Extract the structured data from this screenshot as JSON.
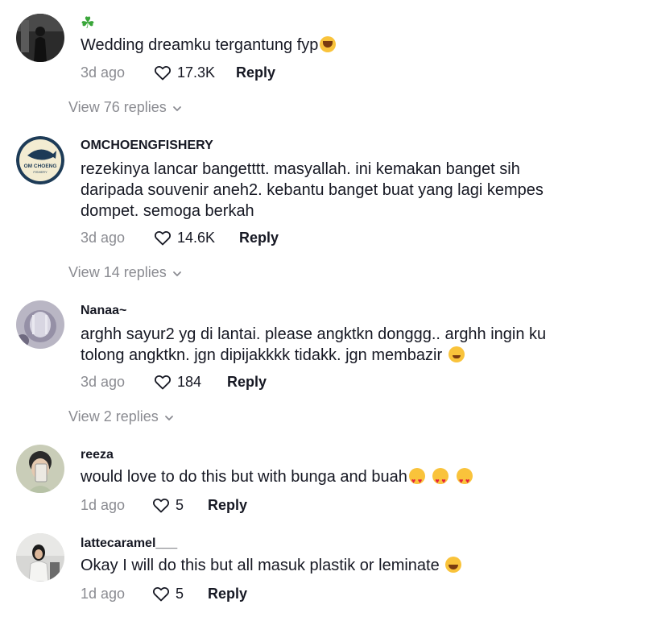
{
  "comments": [
    {
      "username": "☘",
      "text": "Wedding dreamku tergantung fyp",
      "time": "3d ago",
      "likes": "17.3K",
      "reply_label": "Reply",
      "view_replies": "View 76 replies",
      "avatar_icon": "person-photo-avatar"
    },
    {
      "username": "OMCHOENGFISHERY",
      "text": "rezekinya lancar bangetttt. masyallah. ini kemakan banget sih daripada souvenir aneh2. kebantu banget buat yang lagi kempes dompet. semoga berkah",
      "time": "3d ago",
      "likes": "14.6K",
      "reply_label": "Reply",
      "view_replies": "View 14 replies",
      "avatar_logo_text": "OM CHOENG",
      "avatar_logo_subtext": "FISHERY",
      "avatar_icon": "fishery-logo-avatar"
    },
    {
      "username": "Nanaa~",
      "text": "arghh sayur2 yg di lantai. please angktkn donggg.. arghh ingin ku tolong angktkn. jgn dipijakkkk tidakk. jgn membazir",
      "time": "3d ago",
      "likes": "184",
      "reply_label": "Reply",
      "view_replies": "View 2 replies",
      "avatar_icon": "cat-photo-avatar"
    },
    {
      "username": "reeza",
      "text": "would love to do this but with bunga and buah",
      "time": "1d ago",
      "likes": "5",
      "reply_label": "Reply",
      "avatar_icon": "selfie-photo-avatar"
    },
    {
      "username": "lattecaramel___",
      "text": "Okay I will do this but all masuk plastik or leminate",
      "time": "1d ago",
      "likes": "5",
      "reply_label": "Reply",
      "avatar_icon": "person-photo-avatar"
    }
  ],
  "icons": {
    "like": "heart-outline-icon",
    "expand": "chevron-down-icon"
  }
}
